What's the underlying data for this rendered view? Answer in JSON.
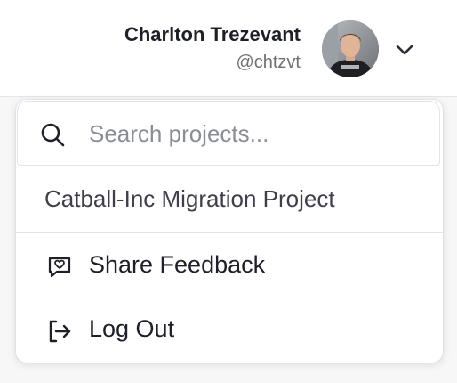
{
  "header": {
    "user_name": "Charlton Trezevant",
    "user_handle": "@chtzvt",
    "avatar_icon": "user-avatar-photo",
    "menu_toggle_icon": "chevron-down-icon"
  },
  "dropdown": {
    "search": {
      "placeholder": "Search projects...",
      "value": "",
      "icon": "search-icon"
    },
    "projects": [
      {
        "label": "Catball-Inc Migration Project"
      }
    ],
    "menu_items": [
      {
        "label": "Share Feedback",
        "icon": "feedback-chat-icon"
      },
      {
        "label": "Log Out",
        "icon": "logout-icon"
      }
    ]
  },
  "colors": {
    "text_primary": "#1f1f2a",
    "text_secondary": "#6f7078",
    "border": "#e2e2e8",
    "background": "#f7f7f8"
  }
}
